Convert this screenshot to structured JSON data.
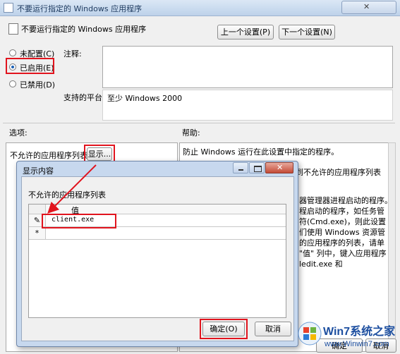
{
  "main_window": {
    "title": "不要运行指定的 Windows 应用程序",
    "close_glyph": "✕"
  },
  "policy": {
    "heading": "不要运行指定的 Windows 应用程序",
    "prev_button": "上一个设置(P)",
    "next_button": "下一个设置(N)"
  },
  "state_options": [
    {
      "label": "未配置(C)",
      "selected": false
    },
    {
      "label": "已启用(E)",
      "selected": true
    },
    {
      "label": "已禁用(D)",
      "selected": false
    }
  ],
  "comment": {
    "label": "注释:",
    "value": ""
  },
  "platform": {
    "label": "支持的平台:",
    "value": "至少 Windows 2000"
  },
  "sections": {
    "options_label": "选项:",
    "help_label": "帮助:"
  },
  "options": {
    "list_label": "不允许的应用程序列表",
    "show_button": "显示..."
  },
  "help": {
    "lines": [
      "防止 Windows 运行在此设置中指定的程序。",
      "到不允许的应用程序列表",
      "器管理器进程启动的程序。",
      "程启动的程序，如任务管",
      "符(Cmd.exe)，则此设置",
      "们使用 Windows 资源管",
      "的应用程序的列表，请单",
      "\"值\" 列中，键入应用程序",
      "ledit.exe 和"
    ]
  },
  "main_buttons": {
    "ok_partial": "确定",
    "cancel_partial": "取消"
  },
  "dialog": {
    "title": "显示内容",
    "list_label": "不允许的应用程序列表",
    "column_header": "值",
    "rows": [
      {
        "marker": "✎",
        "value": "client.exe"
      },
      {
        "marker": "*",
        "value": ""
      }
    ],
    "ok_button": "确定(O)",
    "cancel_button": "取消"
  },
  "watermark": {
    "brand": "Win7系统之家",
    "url": "www.Winwin7.com"
  },
  "colors": {
    "highlight": "#e1141e",
    "accent": "#1a5fb4",
    "title_bar": "#bdd2ea"
  }
}
